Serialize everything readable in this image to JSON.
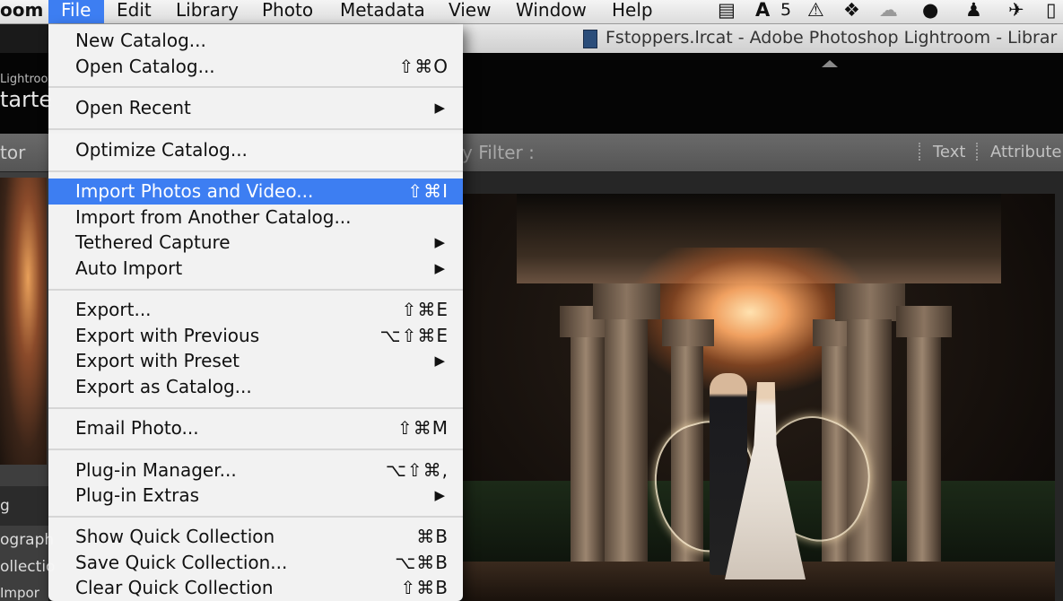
{
  "menubar": {
    "app_fragment": "oom",
    "menus": [
      "File",
      "Edit",
      "Library",
      "Photo",
      "Metadata",
      "View",
      "Window",
      "Help"
    ],
    "active_menu": "File",
    "tray_badge": "5"
  },
  "window": {
    "title": "Fstoppers.lrcat - Adobe Photoshop Lightroom - Librar",
    "identity_small": "Lightroo",
    "identity_large": "tarte",
    "left_panel_label": "tor",
    "filter_label": "y Filter :",
    "filter_options": [
      "Text",
      "Attribute"
    ],
    "left_panel_texts": [
      "g",
      "ograph",
      "ollectio",
      "Impor"
    ]
  },
  "file_menu": {
    "items": [
      {
        "label": "New Catalog...",
        "shortcut": ""
      },
      {
        "label": "Open Catalog...",
        "shortcut": "⇧⌘O"
      },
      {
        "label": "Open Recent",
        "submenu": true
      },
      {
        "label": "Optimize Catalog...",
        "shortcut": ""
      },
      {
        "label": "Import Photos and Video...",
        "shortcut": "⇧⌘I",
        "highlighted": true
      },
      {
        "label": "Import from Another Catalog...",
        "shortcut": ""
      },
      {
        "label": "Tethered Capture",
        "submenu": true
      },
      {
        "label": "Auto Import",
        "submenu": true
      },
      {
        "label": "Export...",
        "shortcut": "⇧⌘E"
      },
      {
        "label": "Export with Previous",
        "shortcut": "⌥⇧⌘E"
      },
      {
        "label": "Export with Preset",
        "submenu": true
      },
      {
        "label": "Export as Catalog...",
        "shortcut": ""
      },
      {
        "label": "Email Photo...",
        "shortcut": "⇧⌘M"
      },
      {
        "label": "Plug-in Manager...",
        "shortcut": "⌥⇧⌘,"
      },
      {
        "label": "Plug-in Extras",
        "submenu": true
      },
      {
        "label": "Show Quick Collection",
        "shortcut": "⌘B"
      },
      {
        "label": "Save Quick Collection...",
        "shortcut": "⌥⌘B"
      },
      {
        "label": "Clear Quick Collection",
        "shortcut": "⇧⌘B"
      }
    ]
  },
  "colors": {
    "menu_highlight": "#3d7ef2",
    "menubar_bg": "#e8e8e8",
    "lightroom_panel": "#3e3e3e"
  },
  "icons": {
    "submenu": "▶",
    "tray": [
      "film-strip-icon",
      "adobe-icon",
      "warning-icon",
      "dropbox-icon",
      "creative-cloud-icon",
      "notification-icon",
      "bell-icon",
      "bird-icon",
      "battery-icon"
    ]
  }
}
